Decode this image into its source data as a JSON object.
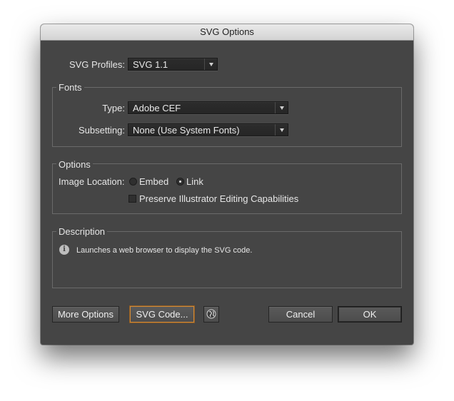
{
  "window": {
    "title": "SVG Options"
  },
  "profiles": {
    "label": "SVG Profiles:",
    "value": "SVG 1.1"
  },
  "fonts": {
    "group_title": "Fonts",
    "type_label": "Type:",
    "type_value": "Adobe CEF",
    "subsetting_label": "Subsetting:",
    "subsetting_value": "None (Use System Fonts)"
  },
  "options": {
    "group_title": "Options",
    "image_location_label": "Image Location:",
    "embed_label": "Embed",
    "link_label": "Link",
    "selected": "Link",
    "preserve_label": "Preserve Illustrator Editing Capabilities",
    "preserve_checked": false
  },
  "description": {
    "group_title": "Description",
    "icon": "info-icon",
    "text": "Launches a web browser to display the SVG code."
  },
  "buttons": {
    "more_options": "More Options",
    "svg_code": "SVG Code...",
    "web_icon": "globe-icon",
    "cancel": "Cancel",
    "ok": "OK"
  },
  "colors": {
    "dialog_bg": "#454545",
    "focus_ring": "#d08b3a"
  }
}
